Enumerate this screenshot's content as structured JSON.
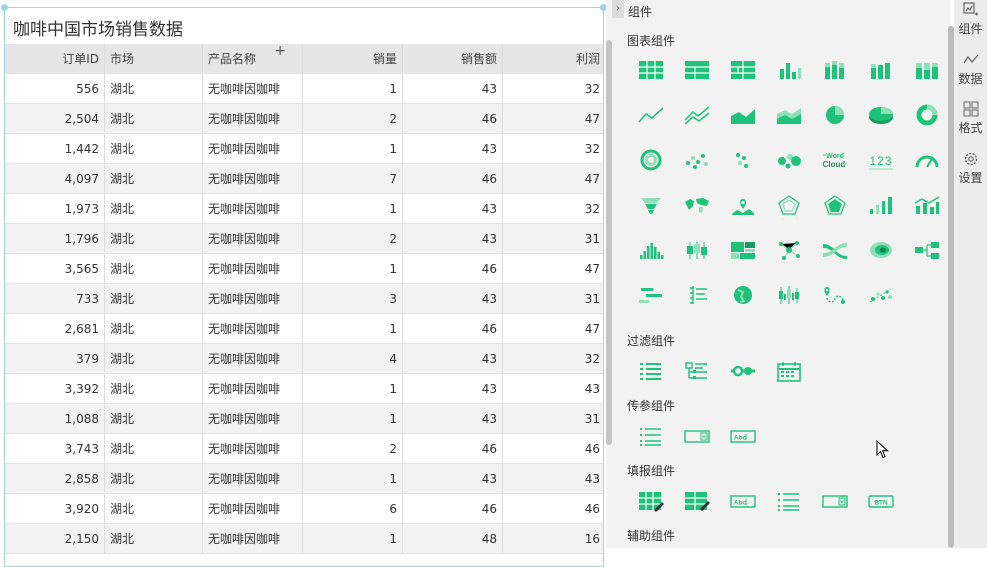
{
  "widget": {
    "title": "咖啡中国市场销售数据",
    "add_column_label": "+"
  },
  "table": {
    "columns": [
      "订单ID",
      "市场",
      "产品名称",
      "销量",
      "销售额",
      "利润"
    ],
    "rows": [
      [
        "556",
        "湖北",
        "无咖啡因咖啡",
        "1",
        "43",
        "32"
      ],
      [
        "2,504",
        "湖北",
        "无咖啡因咖啡",
        "2",
        "46",
        "47"
      ],
      [
        "1,442",
        "湖北",
        "无咖啡因咖啡",
        "1",
        "43",
        "32"
      ],
      [
        "4,097",
        "湖北",
        "无咖啡因咖啡",
        "7",
        "46",
        "47"
      ],
      [
        "1,973",
        "湖北",
        "无咖啡因咖啡",
        "1",
        "43",
        "32"
      ],
      [
        "1,796",
        "湖北",
        "无咖啡因咖啡",
        "2",
        "43",
        "31"
      ],
      [
        "3,565",
        "湖北",
        "无咖啡因咖啡",
        "1",
        "46",
        "47"
      ],
      [
        "733",
        "湖北",
        "无咖啡因咖啡",
        "3",
        "43",
        "31"
      ],
      [
        "2,681",
        "湖北",
        "无咖啡因咖啡",
        "1",
        "46",
        "47"
      ],
      [
        "379",
        "湖北",
        "无咖啡因咖啡",
        "4",
        "43",
        "32"
      ],
      [
        "3,392",
        "湖北",
        "无咖啡因咖啡",
        "1",
        "43",
        "43"
      ],
      [
        "1,088",
        "湖北",
        "无咖啡因咖啡",
        "1",
        "43",
        "31"
      ],
      [
        "3,743",
        "湖北",
        "无咖啡因咖啡",
        "2",
        "46",
        "46"
      ],
      [
        "2,858",
        "湖北",
        "无咖啡因咖啡",
        "1",
        "43",
        "43"
      ],
      [
        "3,920",
        "湖北",
        "无咖啡因咖啡",
        "6",
        "46",
        "46"
      ],
      [
        "2,150",
        "湖北",
        "无咖啡因咖啡",
        "1",
        "48",
        "16"
      ]
    ]
  },
  "panel": {
    "title": "组件",
    "accent_color": "#1ec27a",
    "sections": [
      {
        "label": "图表组件",
        "icons": [
          "table-icon",
          "cross-table-icon",
          "grouped-table-icon",
          "bar-chart-icon",
          "stacked-bar-icon",
          "percent-bar-icon",
          "stacked-percent-bar-icon",
          "line-chart-icon",
          "multi-line-icon",
          "area-chart-icon",
          "stacked-area-icon",
          "pie-chart-icon",
          "3d-pie-icon",
          "donut-chart-icon",
          "nested-donut-icon",
          "scatter-icon",
          "dot-plot-icon",
          "bubble-chart-icon",
          "word-cloud-icon",
          "kpi-number-icon",
          "gauge-icon",
          "funnel-icon",
          "world-map-icon",
          "location-map-icon",
          "radar-icon",
          "filled-radar-icon",
          "step-chart-icon",
          "combo-chart-icon",
          "histogram-icon",
          "box-plot-icon",
          "treemap-icon",
          "network-graph-icon",
          "sankey-icon",
          "heat-map-icon",
          "tree-diagram-icon",
          "gantt-icon",
          "parallel-axis-icon",
          "globe-icon",
          "candlestick-icon",
          "route-map-icon",
          "custom-scatter-icon"
        ]
      },
      {
        "label": "过滤组件",
        "icons": [
          "list-filter-icon",
          "tree-filter-icon",
          "slider-filter-icon",
          "date-filter-icon"
        ]
      },
      {
        "label": "传参组件",
        "icons": [
          "param-list-icon",
          "param-dropdown-icon",
          "param-textbox-icon"
        ]
      },
      {
        "label": "填报组件",
        "icons": [
          "fill-table-icon",
          "fill-edit-table-icon",
          "fill-textbox-icon",
          "fill-list-icon",
          "fill-dropdown-icon",
          "fill-button-icon"
        ]
      },
      {
        "label": "辅助组件",
        "icons": []
      }
    ],
    "word_cloud_text": "Word Cloud",
    "kpi_text": "123",
    "textbox_text": "Abc",
    "button_text": "BTN"
  },
  "tabs": [
    {
      "label": "组件",
      "icon": "components-icon"
    },
    {
      "label": "数据",
      "icon": "data-icon"
    },
    {
      "label": "格式",
      "icon": "format-icon"
    },
    {
      "label": "设置",
      "icon": "settings-icon"
    }
  ]
}
